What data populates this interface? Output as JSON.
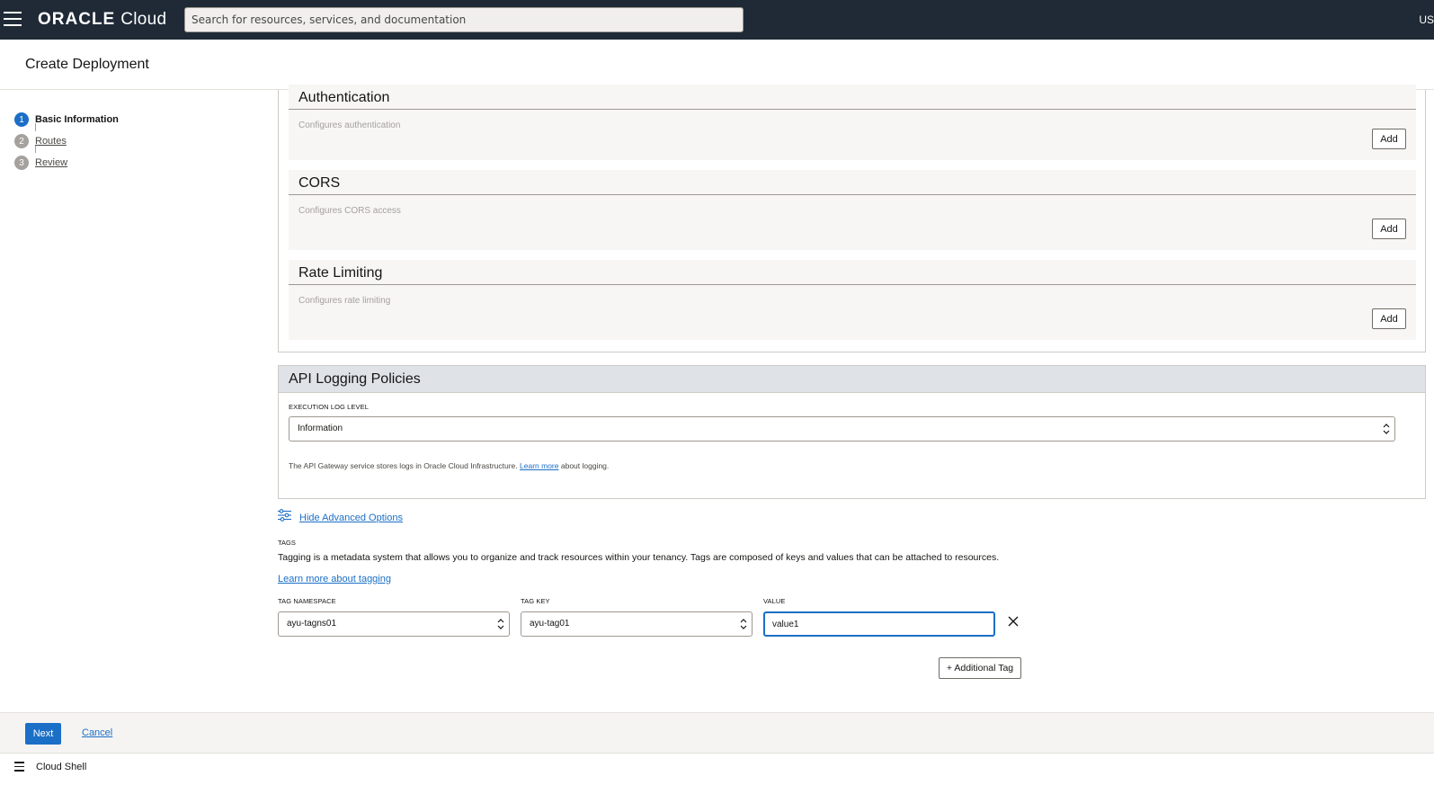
{
  "topbar": {
    "logo_brand": "ORACLE",
    "logo_product": "Cloud",
    "search_placeholder": "Search for resources, services, and documentation",
    "region": "US"
  },
  "page": {
    "title": "Create Deployment"
  },
  "steps": [
    {
      "number": "1",
      "label": "Basic Information",
      "active": true
    },
    {
      "number": "2",
      "label": "Routes",
      "active": false
    },
    {
      "number": "3",
      "label": "Review",
      "active": false
    }
  ],
  "policies": [
    {
      "title": "Authentication",
      "description": "Configures authentication",
      "button": "Add"
    },
    {
      "title": "CORS",
      "description": "Configures CORS access",
      "button": "Add"
    },
    {
      "title": "Rate Limiting",
      "description": "Configures rate limiting",
      "button": "Add"
    }
  ],
  "logging": {
    "title": "API Logging Policies",
    "level_label": "EXECUTION LOG LEVEL",
    "level_value": "Information",
    "note_before": "The API Gateway service stores logs in Oracle Cloud Infrastructure.",
    "note_link": "Learn more",
    "note_after": "about logging."
  },
  "advanced": {
    "label": "Hide Advanced Options"
  },
  "tags": {
    "title": "TAGS",
    "description": "Tagging is a metadata system that allows you to organize and track resources within your tenancy. Tags are composed of keys and values that can be attached to resources.",
    "learn_link": "Learn more about tagging",
    "namespace_label": "TAG NAMESPACE",
    "namespace_value": "ayu-tagns01",
    "key_label": "TAG KEY",
    "key_value": "ayu-tag01",
    "value_label": "VALUE",
    "value_value": "value1",
    "additional_button": "+ Additional Tag"
  },
  "footer": {
    "next": "Next",
    "cancel": "Cancel"
  },
  "shell": {
    "label": "Cloud Shell"
  },
  "colors": {
    "topbar": "#1f2a36",
    "accent": "#1b6fc7"
  }
}
